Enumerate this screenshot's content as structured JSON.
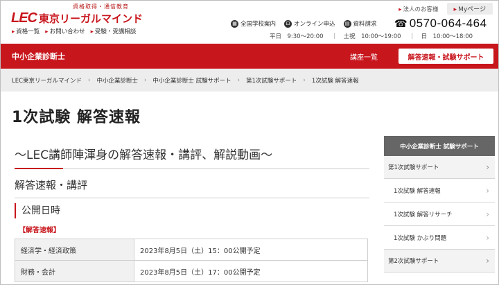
{
  "header": {
    "tagline": "資格取得・通信教育",
    "logo_mark": "LEC",
    "logo_text": "東京リーガルマインド",
    "sub_links": [
      "資格一覧",
      "お問い合わせ",
      "受験・受講相談"
    ],
    "util_links": [
      "法人のお客様"
    ],
    "mypage": "Myページ",
    "contacts": [
      {
        "label": "全国学校案内",
        "icon": "building-icon"
      },
      {
        "label": "オンライン申込",
        "icon": "cart-icon"
      },
      {
        "label": "資料請求",
        "icon": "document-icon"
      }
    ],
    "phone": "0570-064-464",
    "hours": [
      "平日　9:30～20:00",
      "｜　土祝　10:00～19:00",
      "｜　日　10:00～18:00"
    ]
  },
  "nav": {
    "title": "中小企業診断士",
    "courses": "講座一覧",
    "support": "解答速報・試験サポート",
    "accent": "#c8161d"
  },
  "breadcrumb": [
    "LEC東京リーガルマインド",
    "中小企業診断士",
    "中小企業診断士 試験サポート",
    "第1次試験サポート",
    "1次試験 解答速報"
  ],
  "page": {
    "title": "1次試験 解答速報",
    "lead": "～LEC講師陣渾身の解答速報・講評、解説動画～",
    "section": "解答速報・講評",
    "subsection": "公開日時",
    "label": "【解答速報】",
    "schedule": [
      {
        "subject": "経済学・経済政策",
        "time": "2023年8月5日（土）15：00公開予定"
      },
      {
        "subject": "財務・会計",
        "time": "2023年8月5日（土）17：00公開予定"
      }
    ]
  },
  "sidebar": {
    "head": "中小企業診断士 試験サポート",
    "items": [
      {
        "label": "第1次試験サポート",
        "level": 1
      },
      {
        "label": "1次試験 解答速報",
        "level": 2
      },
      {
        "label": "1次試験 解答リサーチ",
        "level": 2
      },
      {
        "label": "1次試験 かぶり問題",
        "level": 2
      },
      {
        "label": "第2次試験サポート",
        "level": 1
      }
    ]
  }
}
